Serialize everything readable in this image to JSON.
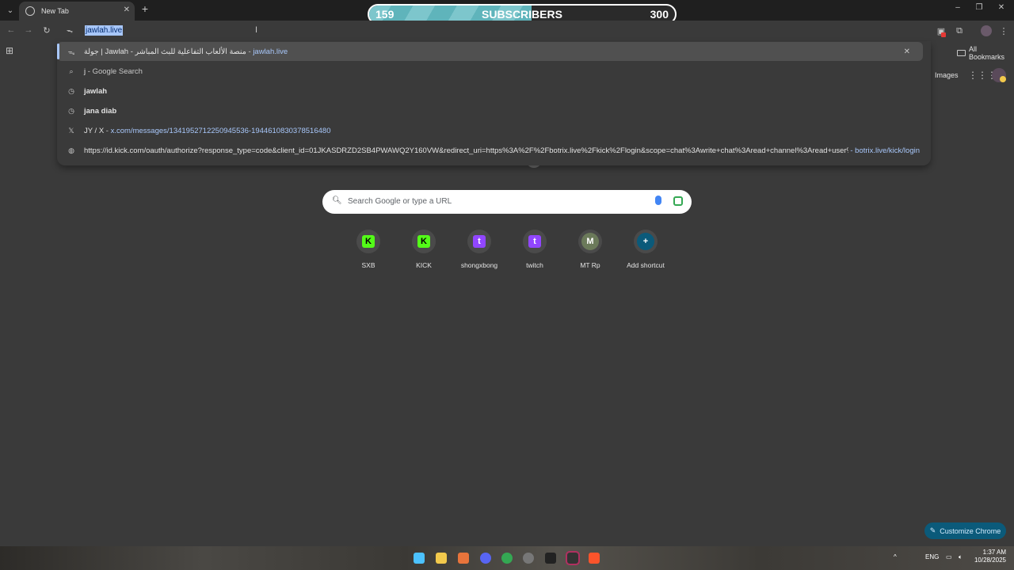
{
  "tabstrip": {
    "tab_title": "New Tab",
    "new_tab": "+",
    "close": "✕"
  },
  "subscriber_bar": {
    "current": "159",
    "label": "SUBSCRIBERS",
    "goal": "300",
    "progress": 0.53
  },
  "omnibox": {
    "typed": "jawlah.live"
  },
  "bookmarks": {
    "all_bookmarks": "All Bookmarks"
  },
  "dropdown": {
    "items": [
      {
        "text": "منصة الألعاب التفاعلية للبث المباشر - Jawlah | جولة",
        "sep": " - ",
        "url": "jawlah.live",
        "icon": "site-favicon",
        "selected": true
      },
      {
        "text": "j",
        "sep": " - ",
        "url": "Google Search",
        "icon": "search-icon"
      },
      {
        "text": "jawlah",
        "sep": "",
        "url": "",
        "icon": "history-icon"
      },
      {
        "text": "jana diab",
        "sep": "",
        "url": "",
        "icon": "history-icon"
      },
      {
        "text": "JY / X",
        "sep": " - ",
        "url": "x.com/messages/1341952712250945536-1944610830378516480",
        "icon": "x-logo-icon"
      },
      {
        "text": "https://id.kick.com/oauth/authorize?response_type=code&client_id=01JKASDRZD2SB4PWAWQ2Y160VW&redirect_uri=https%3A%2F%2Fbotrix.live%2Fkick%2Flogin&scope=chat%3Awrite+chat%3Aread+channel%3Aread+user%3Aread+events%3A...",
        "sep": "",
        "url": "",
        "right": "- botrix.live/kick/login",
        "icon": "globe-icon"
      }
    ]
  },
  "header": {
    "images": "Images"
  },
  "search": {
    "placeholder": "Search Google or type a URL"
  },
  "shortcuts": [
    {
      "label": "SXB",
      "glyph": "K",
      "color": "#53fc18"
    },
    {
      "label": "KICK",
      "glyph": "K",
      "color": "#53fc18"
    },
    {
      "label": "shongxbong",
      "glyph": "t",
      "color": "#9146ff"
    },
    {
      "label": "twitch",
      "glyph": "t",
      "color": "#9146ff"
    },
    {
      "label": "MT Rp",
      "glyph": "M",
      "color": "#6b7a5a"
    },
    {
      "label": "Add shortcut",
      "glyph": "+",
      "color": "#0b5a7a"
    }
  ],
  "customize": {
    "label": "Customize Chrome"
  },
  "taskbar": {
    "lang": "ENG",
    "time": "1:37 AM",
    "date": "10/28/2025"
  }
}
